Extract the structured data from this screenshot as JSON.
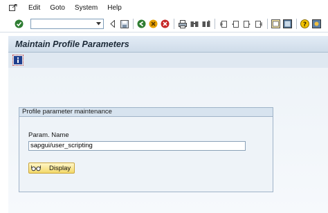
{
  "menubar": {
    "items": [
      {
        "label": "Edit"
      },
      {
        "label": "Goto"
      },
      {
        "label": "System"
      },
      {
        "label": "Help"
      }
    ]
  },
  "toolbar": {
    "command_field_value": ""
  },
  "titlebar": {
    "title": "Maintain Profile Parameters"
  },
  "groupbox": {
    "title": "Profile parameter maintenance",
    "param_label": "Param. Name",
    "param_value": "sapgui/user_scripting",
    "display_label": "Display"
  },
  "colors": {
    "title_bg": "#d5e1ec",
    "content_bg": "#eef3f8",
    "button_bg": "#f3d96a"
  }
}
